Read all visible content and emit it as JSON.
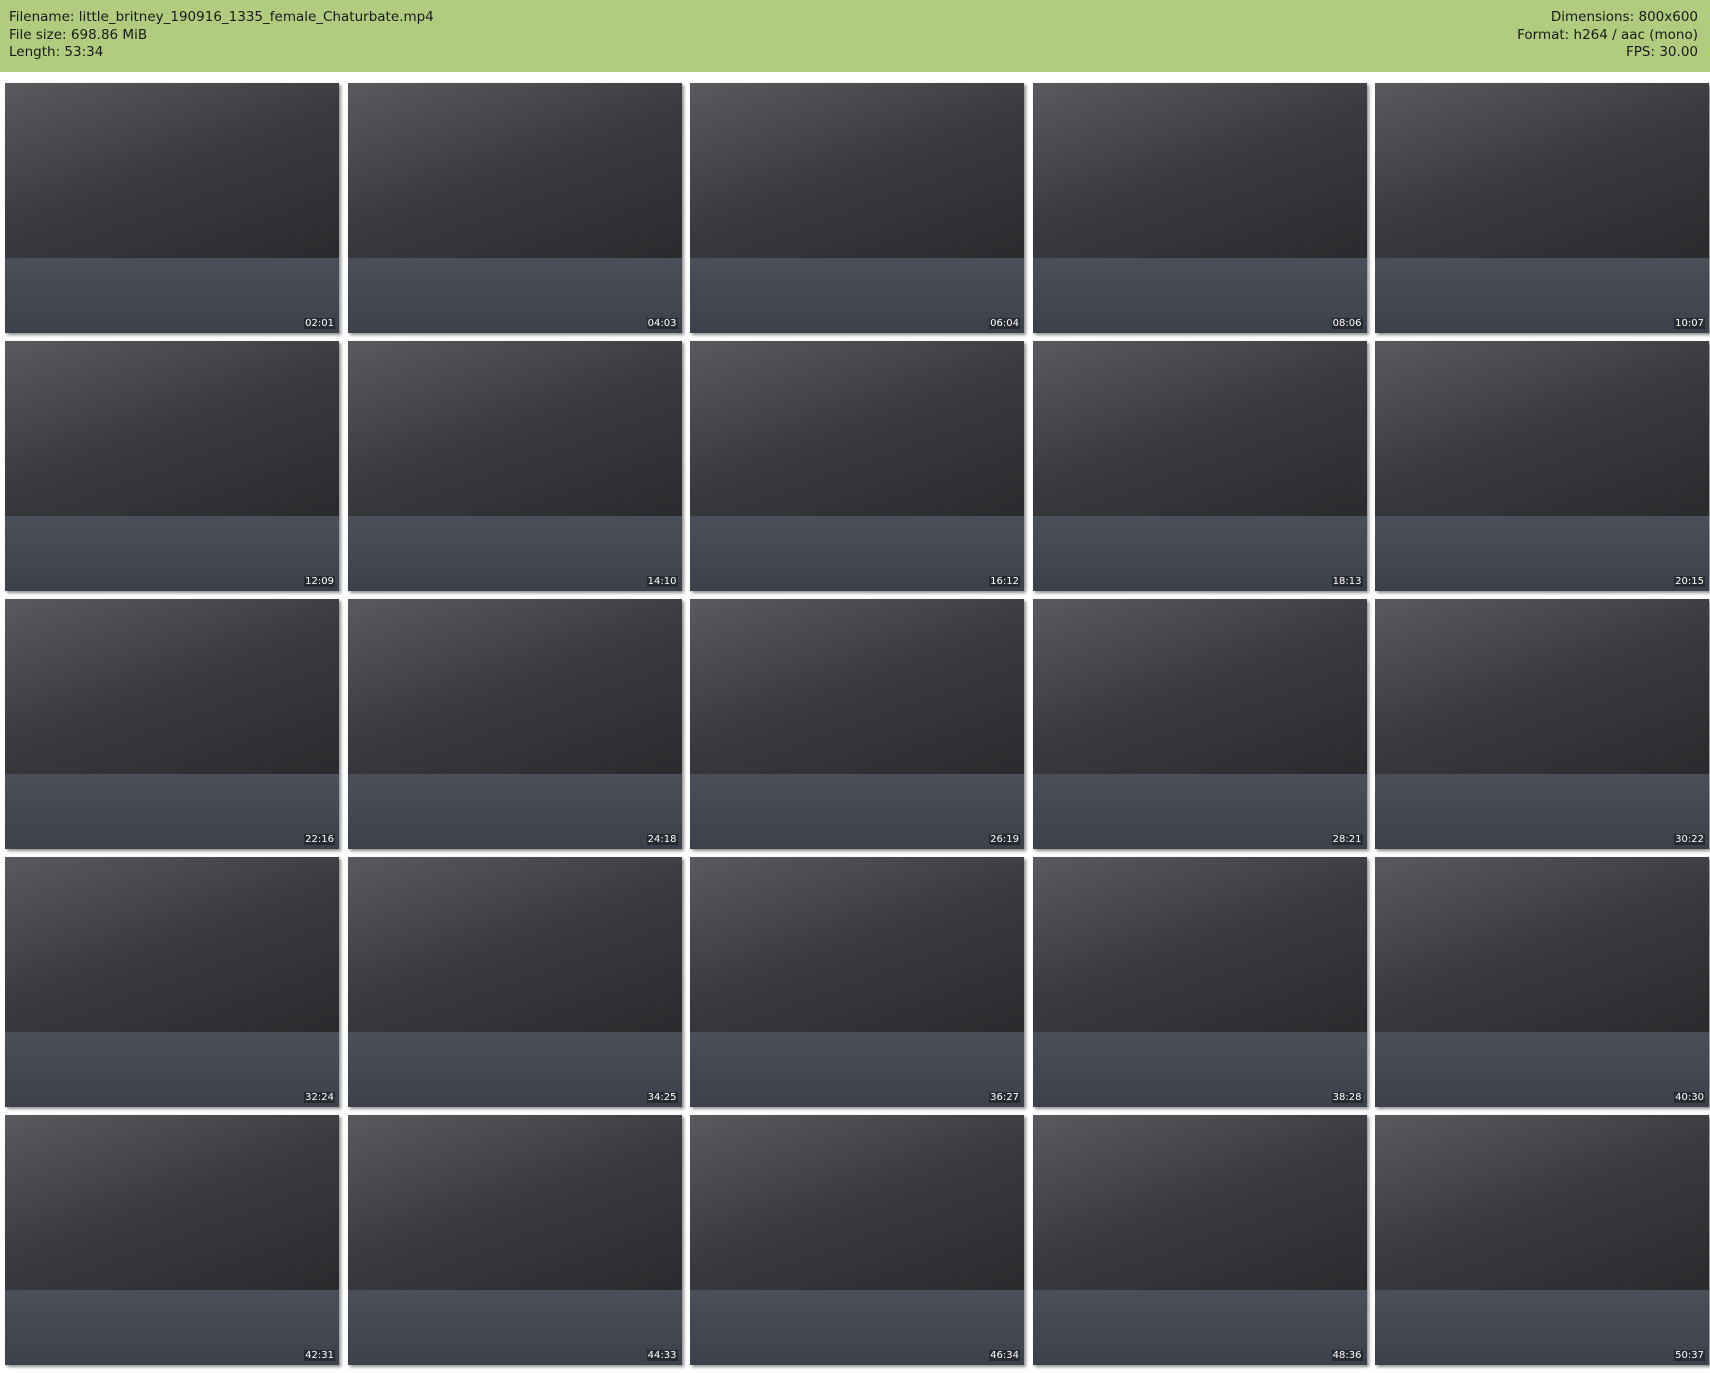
{
  "header": {
    "filename": "Filename: little_britney_190916_1335_female_Chaturbate.mp4",
    "file_size": "File size: 698.86 MiB",
    "length": "Length: 53:34",
    "dimensions": "Dimensions: 800x600",
    "format": "Format: h264 / aac (mono)",
    "fps": "FPS: 30.00"
  },
  "colors": {
    "header_bg": "#b1cc7e"
  },
  "thumbnails": [
    "02:01",
    "04:03",
    "06:04",
    "08:06",
    "10:07",
    "12:09",
    "14:10",
    "16:12",
    "18:13",
    "20:15",
    "22:16",
    "24:18",
    "26:19",
    "28:21",
    "30:22",
    "32:24",
    "34:25",
    "36:27",
    "38:28",
    "40:30",
    "42:31",
    "44:33",
    "46:34",
    "48:36",
    "50:37"
  ]
}
